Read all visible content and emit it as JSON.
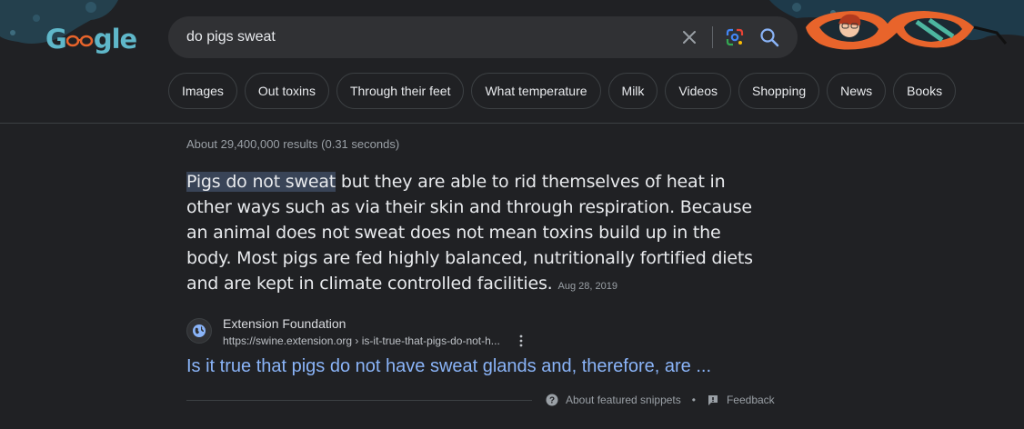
{
  "search": {
    "query": "do pigs sweat"
  },
  "logo": {
    "text_before": "G",
    "text_after": "gle"
  },
  "chips": [
    "Images",
    "Out toxins",
    "Through their feet",
    "What temperature",
    "Milk",
    "Videos",
    "Shopping",
    "News",
    "Books"
  ],
  "results": {
    "stats": "About 29,400,000 results (0.31 seconds)",
    "snippet_highlight": "Pigs do not sweat",
    "snippet_rest": " but they are able to rid themselves of heat in other ways such as via their skin and through respiration. Because an animal does not sweat does not mean toxins build up in the body. Most pigs are fed highly balanced, nutritionally fortified diets and are kept in climate controlled facilities.",
    "snippet_date": "Aug 28, 2019",
    "source_name": "Extension Foundation",
    "source_url": "https://swine.extension.org › is-it-true-that-pigs-do-not-h...",
    "title": "Is it true that pigs do not have sweat glands and, therefore, are ...",
    "about_snippets": "About featured snippets",
    "separator": "•",
    "feedback": "Feedback"
  },
  "colors": {
    "background": "#202124",
    "searchbox": "#303134",
    "link": "#8ab4f8",
    "highlight": "#394457",
    "doodle_frame": "#e8642b",
    "doodle_bg": "#1e3a4a"
  },
  "icons": [
    "clear-icon",
    "lens-icon",
    "search-icon",
    "globe-icon",
    "more-vert-icon",
    "help-icon",
    "feedback-icon"
  ]
}
